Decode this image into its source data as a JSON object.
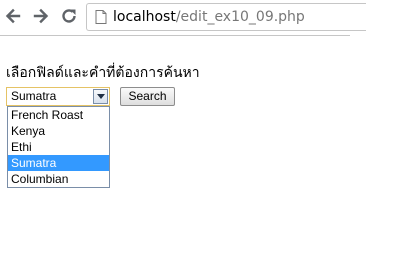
{
  "browser": {
    "url_host": "localhost",
    "url_path": "/edit_ex10_09.php"
  },
  "page": {
    "heading": "เลือกฟิลด์และคำที่ต้องการค้นหา",
    "select_value": "Sumatra",
    "search_label": "Search",
    "options": [
      {
        "label": "French Roast",
        "selected": false
      },
      {
        "label": "Kenya",
        "selected": false
      },
      {
        "label": "Ethi",
        "selected": false
      },
      {
        "label": "Sumatra",
        "selected": true
      },
      {
        "label": "Columbian",
        "selected": false
      }
    ]
  },
  "colors": {
    "highlight": "#3399ff",
    "select_border": "#e5c365"
  }
}
